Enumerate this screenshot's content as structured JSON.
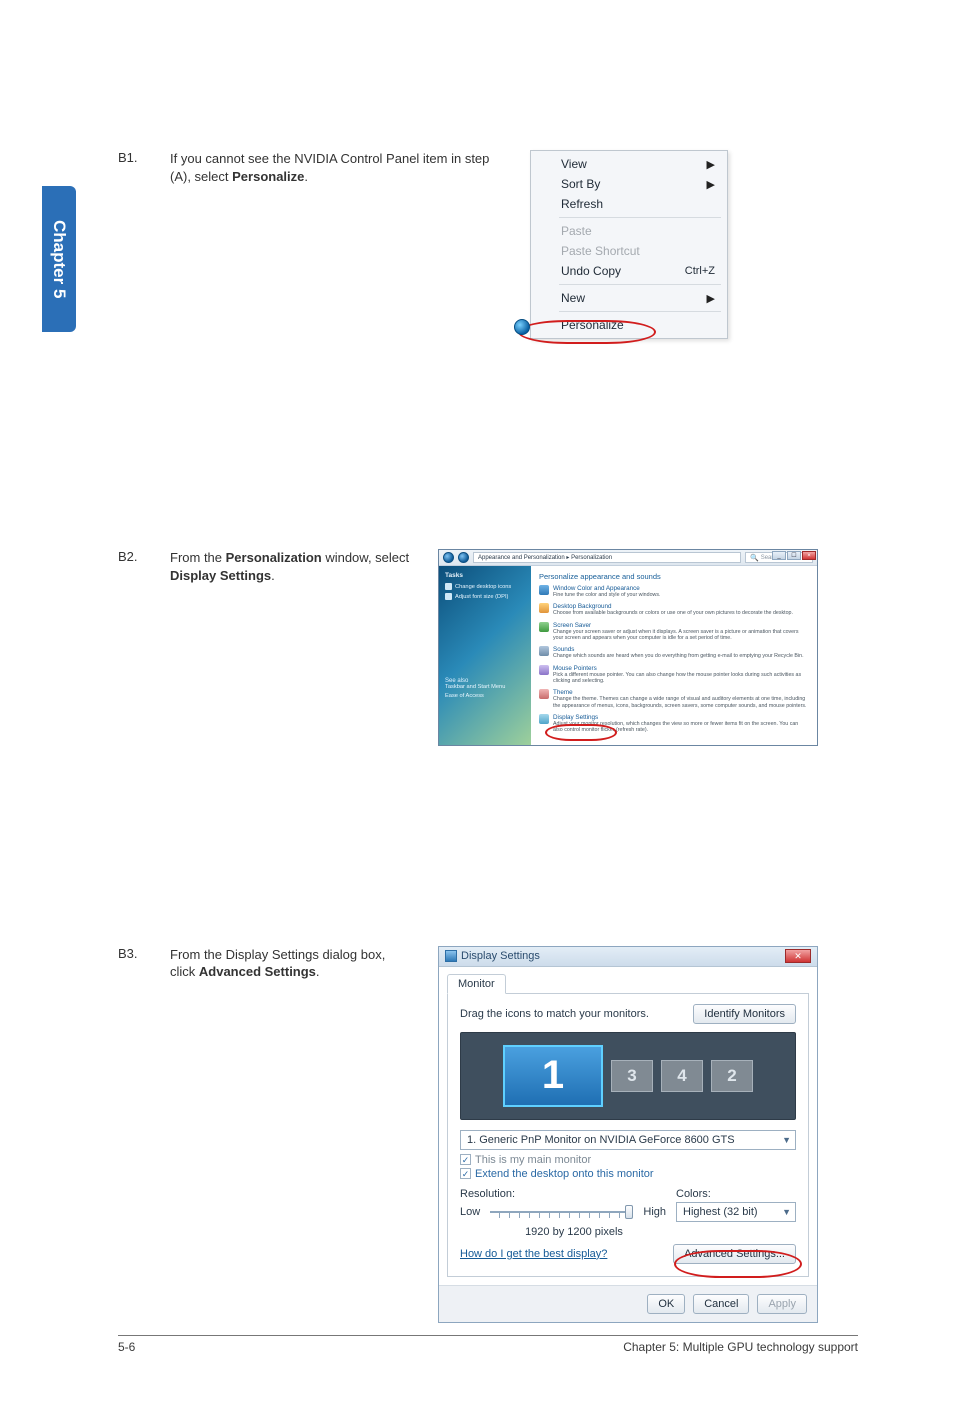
{
  "chapter_tab": "Chapter 5",
  "step_b1": {
    "num": "B1.",
    "text_pre": "If you cannot see the NVIDIA Control Panel item in step (A), select ",
    "text_bold": "Personalize",
    "text_post": "."
  },
  "context_menu": {
    "view": "View",
    "sort_by": "Sort By",
    "refresh": "Refresh",
    "paste": "Paste",
    "paste_shortcut": "Paste Shortcut",
    "undo_copy": "Undo Copy",
    "undo_accel": "Ctrl+Z",
    "new": "New",
    "personalize": "Personalize"
  },
  "step_b2": {
    "num": "B2.",
    "text_a": "From the ",
    "text_b": "Personalization",
    "text_c": " window, select ",
    "text_d": "Display Settings",
    "text_e": "."
  },
  "personalization": {
    "breadcrumb": "Appearance and Personalization  ▸  Personalization",
    "search_placeholder": "Search",
    "sidebar": {
      "tasks": "Tasks",
      "change_icons": "Change desktop icons",
      "adjust_font": "Adjust font size (DPI)",
      "see_also": "See also",
      "taskbar": "Taskbar and Start Menu",
      "ease": "Ease of Access"
    },
    "main_title": "Personalize appearance and sounds",
    "items": [
      {
        "title": "Window Color and Appearance",
        "desc": "Fine tune the color and style of your windows."
      },
      {
        "title": "Desktop Background",
        "desc": "Choose from available backgrounds or colors or use one of your own pictures to decorate the desktop."
      },
      {
        "title": "Screen Saver",
        "desc": "Change your screen saver or adjust when it displays. A screen saver is a picture or animation that covers your screen and appears when your computer is idle for a set period of time."
      },
      {
        "title": "Sounds",
        "desc": "Change which sounds are heard when you do everything from getting e-mail to emptying your Recycle Bin."
      },
      {
        "title": "Mouse Pointers",
        "desc": "Pick a different mouse pointer. You can also change how the mouse pointer looks during such activities as clicking and selecting."
      },
      {
        "title": "Theme",
        "desc": "Change the theme. Themes can change a wide range of visual and auditory elements at one time, including the appearance of menus, icons, backgrounds, screen savers, some computer sounds, and mouse pointers."
      },
      {
        "title": "Display Settings",
        "desc": "Adjust your monitor resolution, which changes the view so more or fewer items fit on the screen. You can also control monitor flicker (refresh rate)."
      }
    ]
  },
  "step_b3": {
    "num": "B3.",
    "text_a": "From the Display Settings dialog box, click ",
    "text_b": "Advanced Settings",
    "text_c": "."
  },
  "display_settings": {
    "title": "Display Settings",
    "tab": "Monitor",
    "drag_text": "Drag the icons to match your monitors.",
    "identify_btn": "Identify Monitors",
    "monitors": {
      "m1": "1",
      "m3": "3",
      "m4": "4",
      "m2": "2"
    },
    "monitor_select": "1. Generic PnP Monitor on NVIDIA GeForce 8600 GTS",
    "chk_main": "This is my main monitor",
    "chk_extend": "Extend the desktop onto this monitor",
    "resolution_label": "Resolution:",
    "colors_label": "Colors:",
    "low": "Low",
    "high": "High",
    "res_value": "1920 by 1200 pixels",
    "colors_value": "Highest (32 bit)",
    "help_link": "How do I get the best display?",
    "advanced_btn": "Advanced Settings...",
    "ok": "OK",
    "cancel": "Cancel",
    "apply": "Apply"
  },
  "footer": {
    "page": "5-6",
    "title": "Chapter 5: Multiple GPU technology support"
  }
}
